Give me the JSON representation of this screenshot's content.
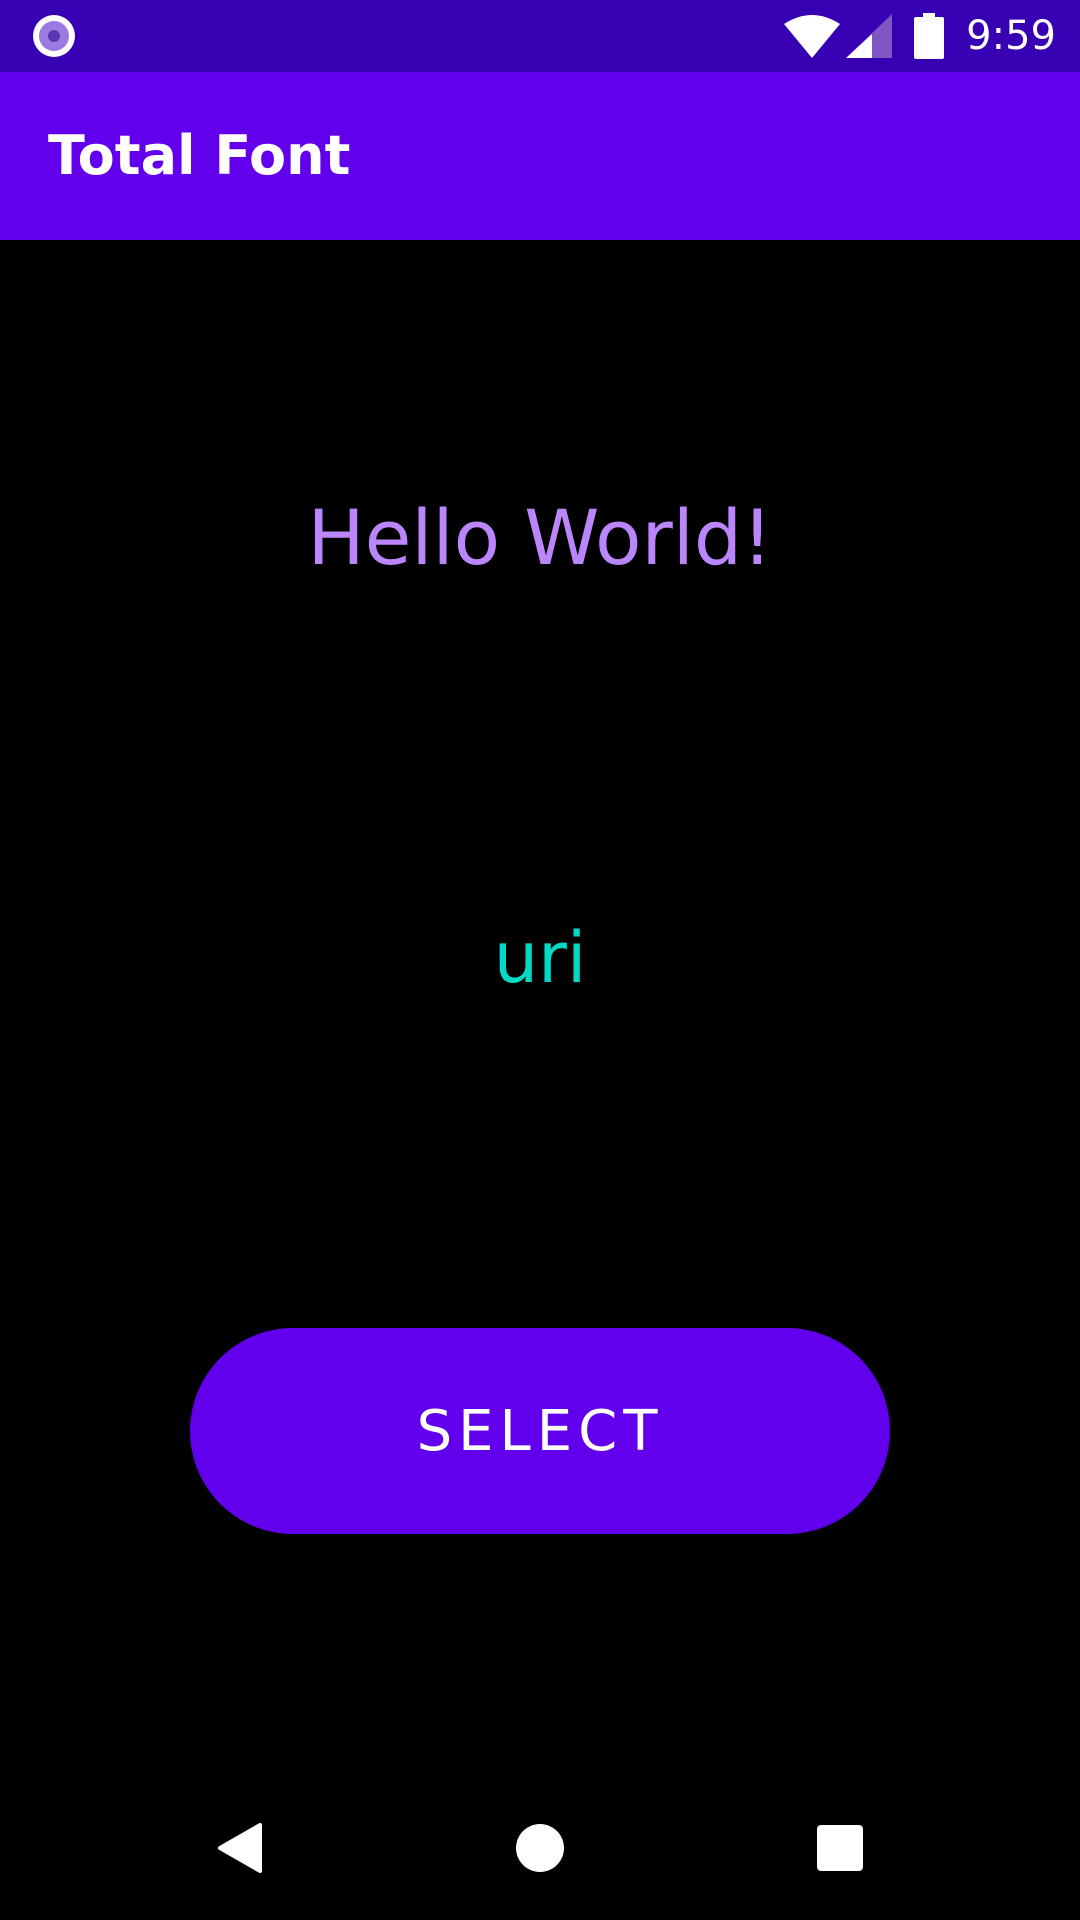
{
  "status_bar": {
    "time": "9:59",
    "icons": [
      "app-notification-icon",
      "wifi-icon",
      "cellular-signal-icon",
      "battery-icon"
    ],
    "background": "#3700B3"
  },
  "app_bar": {
    "title": "Total Font",
    "background": "#6200EE"
  },
  "content": {
    "hello_text": "Hello World!",
    "hello_color": "#BB86FC",
    "uri_text": "uri",
    "uri_color": "#03DAC5"
  },
  "select_button": {
    "label": "SELECT",
    "background": "#6200EE"
  },
  "nav_bar": {
    "icons": [
      "back-icon",
      "home-icon",
      "recents-icon"
    ]
  }
}
